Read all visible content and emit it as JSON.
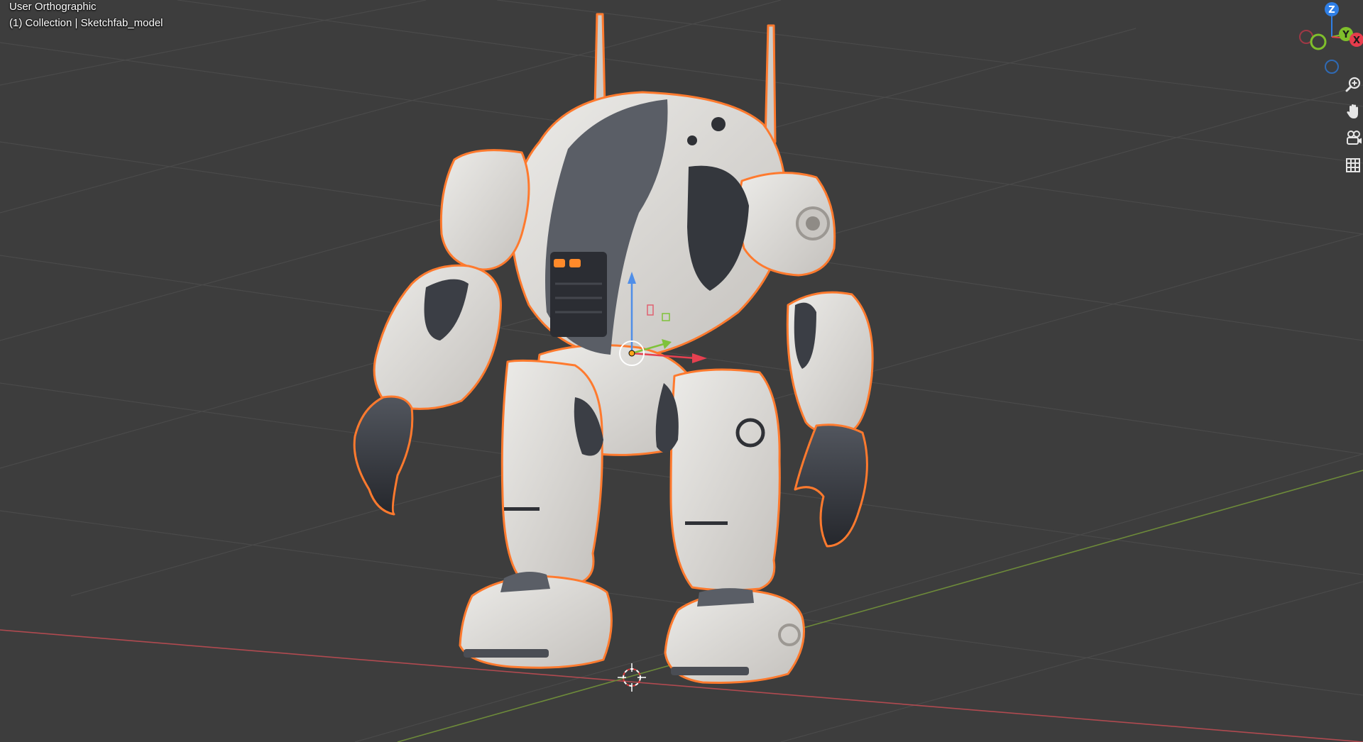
{
  "viewport": {
    "view_name": "User Orthographic",
    "collection_path": "(1) Collection | Sketchfab_model",
    "object_name": "Sketchfab_model"
  },
  "nav_gizmo": {
    "axes": [
      {
        "axis": "Z",
        "color": "#2f7fe6"
      },
      {
        "axis": "Y",
        "color": "#7fbf2b"
      },
      {
        "axis": "X",
        "color": "#e63c4c"
      }
    ]
  },
  "navigation_tools": [
    {
      "name": "zoom",
      "icon": "zoom-icon"
    },
    {
      "name": "pan",
      "icon": "hand-icon"
    },
    {
      "name": "camera-view",
      "icon": "camera-icon"
    },
    {
      "name": "toggle-perspective",
      "icon": "grid-icon"
    }
  ],
  "colors": {
    "background": "#3d3d3d",
    "grid_line": "#4a4a4a",
    "x_axis": "#b04a50",
    "y_axis": "#6d8a3a",
    "selection_outline": "#ff7a2e",
    "robot_body": "#d9d6d2",
    "robot_dark": "#3a3d44"
  }
}
